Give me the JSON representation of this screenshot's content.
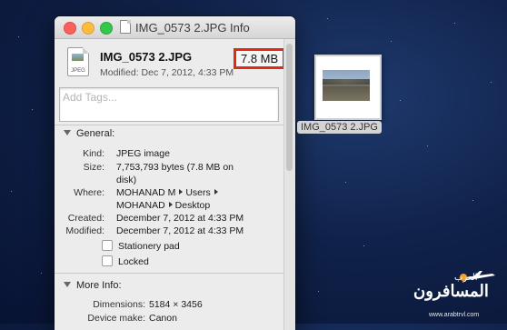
{
  "window": {
    "title": "IMG_0573 2.JPG Info",
    "file_name": "IMG_0573 2.JPG",
    "file_size": "7.8 MB",
    "icon_label": "JPEG",
    "modified_header": "Modified: Dec 7, 2012, 4:33 PM",
    "tags_placeholder": "Add Tags..."
  },
  "general": {
    "title": "General:",
    "kind_label": "Kind:",
    "kind_value": "JPEG image",
    "size_label": "Size:",
    "size_value_line1": "7,753,793 bytes (7.8 MB on",
    "size_value_line2": "disk)",
    "where_label": "Where:",
    "where_1": "MOHANAD M",
    "where_2": "Users",
    "where_3": "MOHANAD",
    "where_4": "Desktop",
    "created_label": "Created:",
    "created_value": "December 7, 2012 at 4:33 PM",
    "modified_label": "Modified:",
    "modified_value": "December 7, 2012 at 4:33 PM",
    "stationery_label": "Stationery pad",
    "locked_label": "Locked"
  },
  "more_info": {
    "title": "More Info:",
    "dimensions_label": "Dimensions:",
    "dimensions_value": "5184 × 3456",
    "device_label": "Device make:",
    "device_value": "Canon"
  },
  "desktop": {
    "file_label": "IMG_0573 2.JPG"
  },
  "watermark": {
    "arabic": "المسافرون",
    "arabic_small": "العرب",
    "url": "www.arabtrvl.com"
  },
  "colors": {
    "highlight_border": "#e02a12",
    "desktop_bg": "#10224a"
  }
}
